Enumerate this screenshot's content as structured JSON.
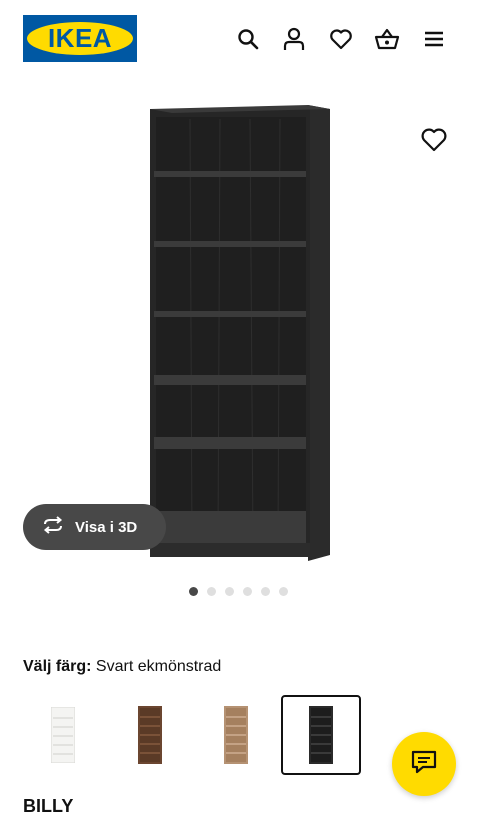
{
  "header": {
    "logo_text": "IKEA",
    "icons": [
      "search-icon",
      "account-icon",
      "heart-icon",
      "basket-icon",
      "menu-icon"
    ]
  },
  "product": {
    "view3d_label": "Visa i 3D",
    "image_count": 6,
    "active_image": 1,
    "color_prompt": "Välj färg:",
    "selected_color": "Svart ekmönstrad",
    "colors": [
      "white",
      "brown",
      "light-oak",
      "black"
    ],
    "name": "BILLY"
  },
  "colors": {
    "brand_blue": "#0058a3",
    "brand_yellow": "#ffdb00",
    "pill_bg": "#484848"
  }
}
